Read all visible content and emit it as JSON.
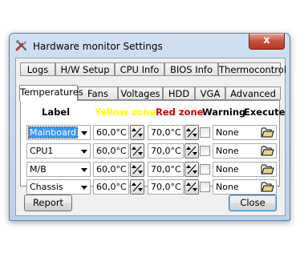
{
  "window": {
    "title": "Hardware monitor Settings",
    "close_label": "x"
  },
  "tabs_row1": [
    "Logs",
    "H/W Setup",
    "CPU Info",
    "BIOS Info",
    "Thermocontrol"
  ],
  "tabs_row2": [
    "Temperatures",
    "Fans",
    "Voltages",
    "HDD",
    "VGA",
    "Advanced"
  ],
  "active_tab": "Temperatures",
  "headers": {
    "label": "Label",
    "yellow": "Yellow zone",
    "red": "Red zone",
    "warning": "Warning",
    "execute": "Execute"
  },
  "colors": {
    "yellow": "#ffff00",
    "red": "#cc0000"
  },
  "rows": [
    {
      "label": "Mainboard",
      "yellow": "60,0°C",
      "red": "70,0°C",
      "warning": false,
      "execute": "None"
    },
    {
      "label": "CPU1",
      "yellow": "60,0°C",
      "red": "70,0°C",
      "warning": false,
      "execute": "None"
    },
    {
      "label": "M/B",
      "yellow": "60,0°C",
      "red": "70,0°C",
      "warning": false,
      "execute": "None"
    },
    {
      "label": "Chassis",
      "yellow": "60,0°C",
      "red": "70,0°C",
      "warning": false,
      "execute": "None"
    }
  ],
  "buttons": {
    "report": "Report",
    "close": "Close"
  }
}
